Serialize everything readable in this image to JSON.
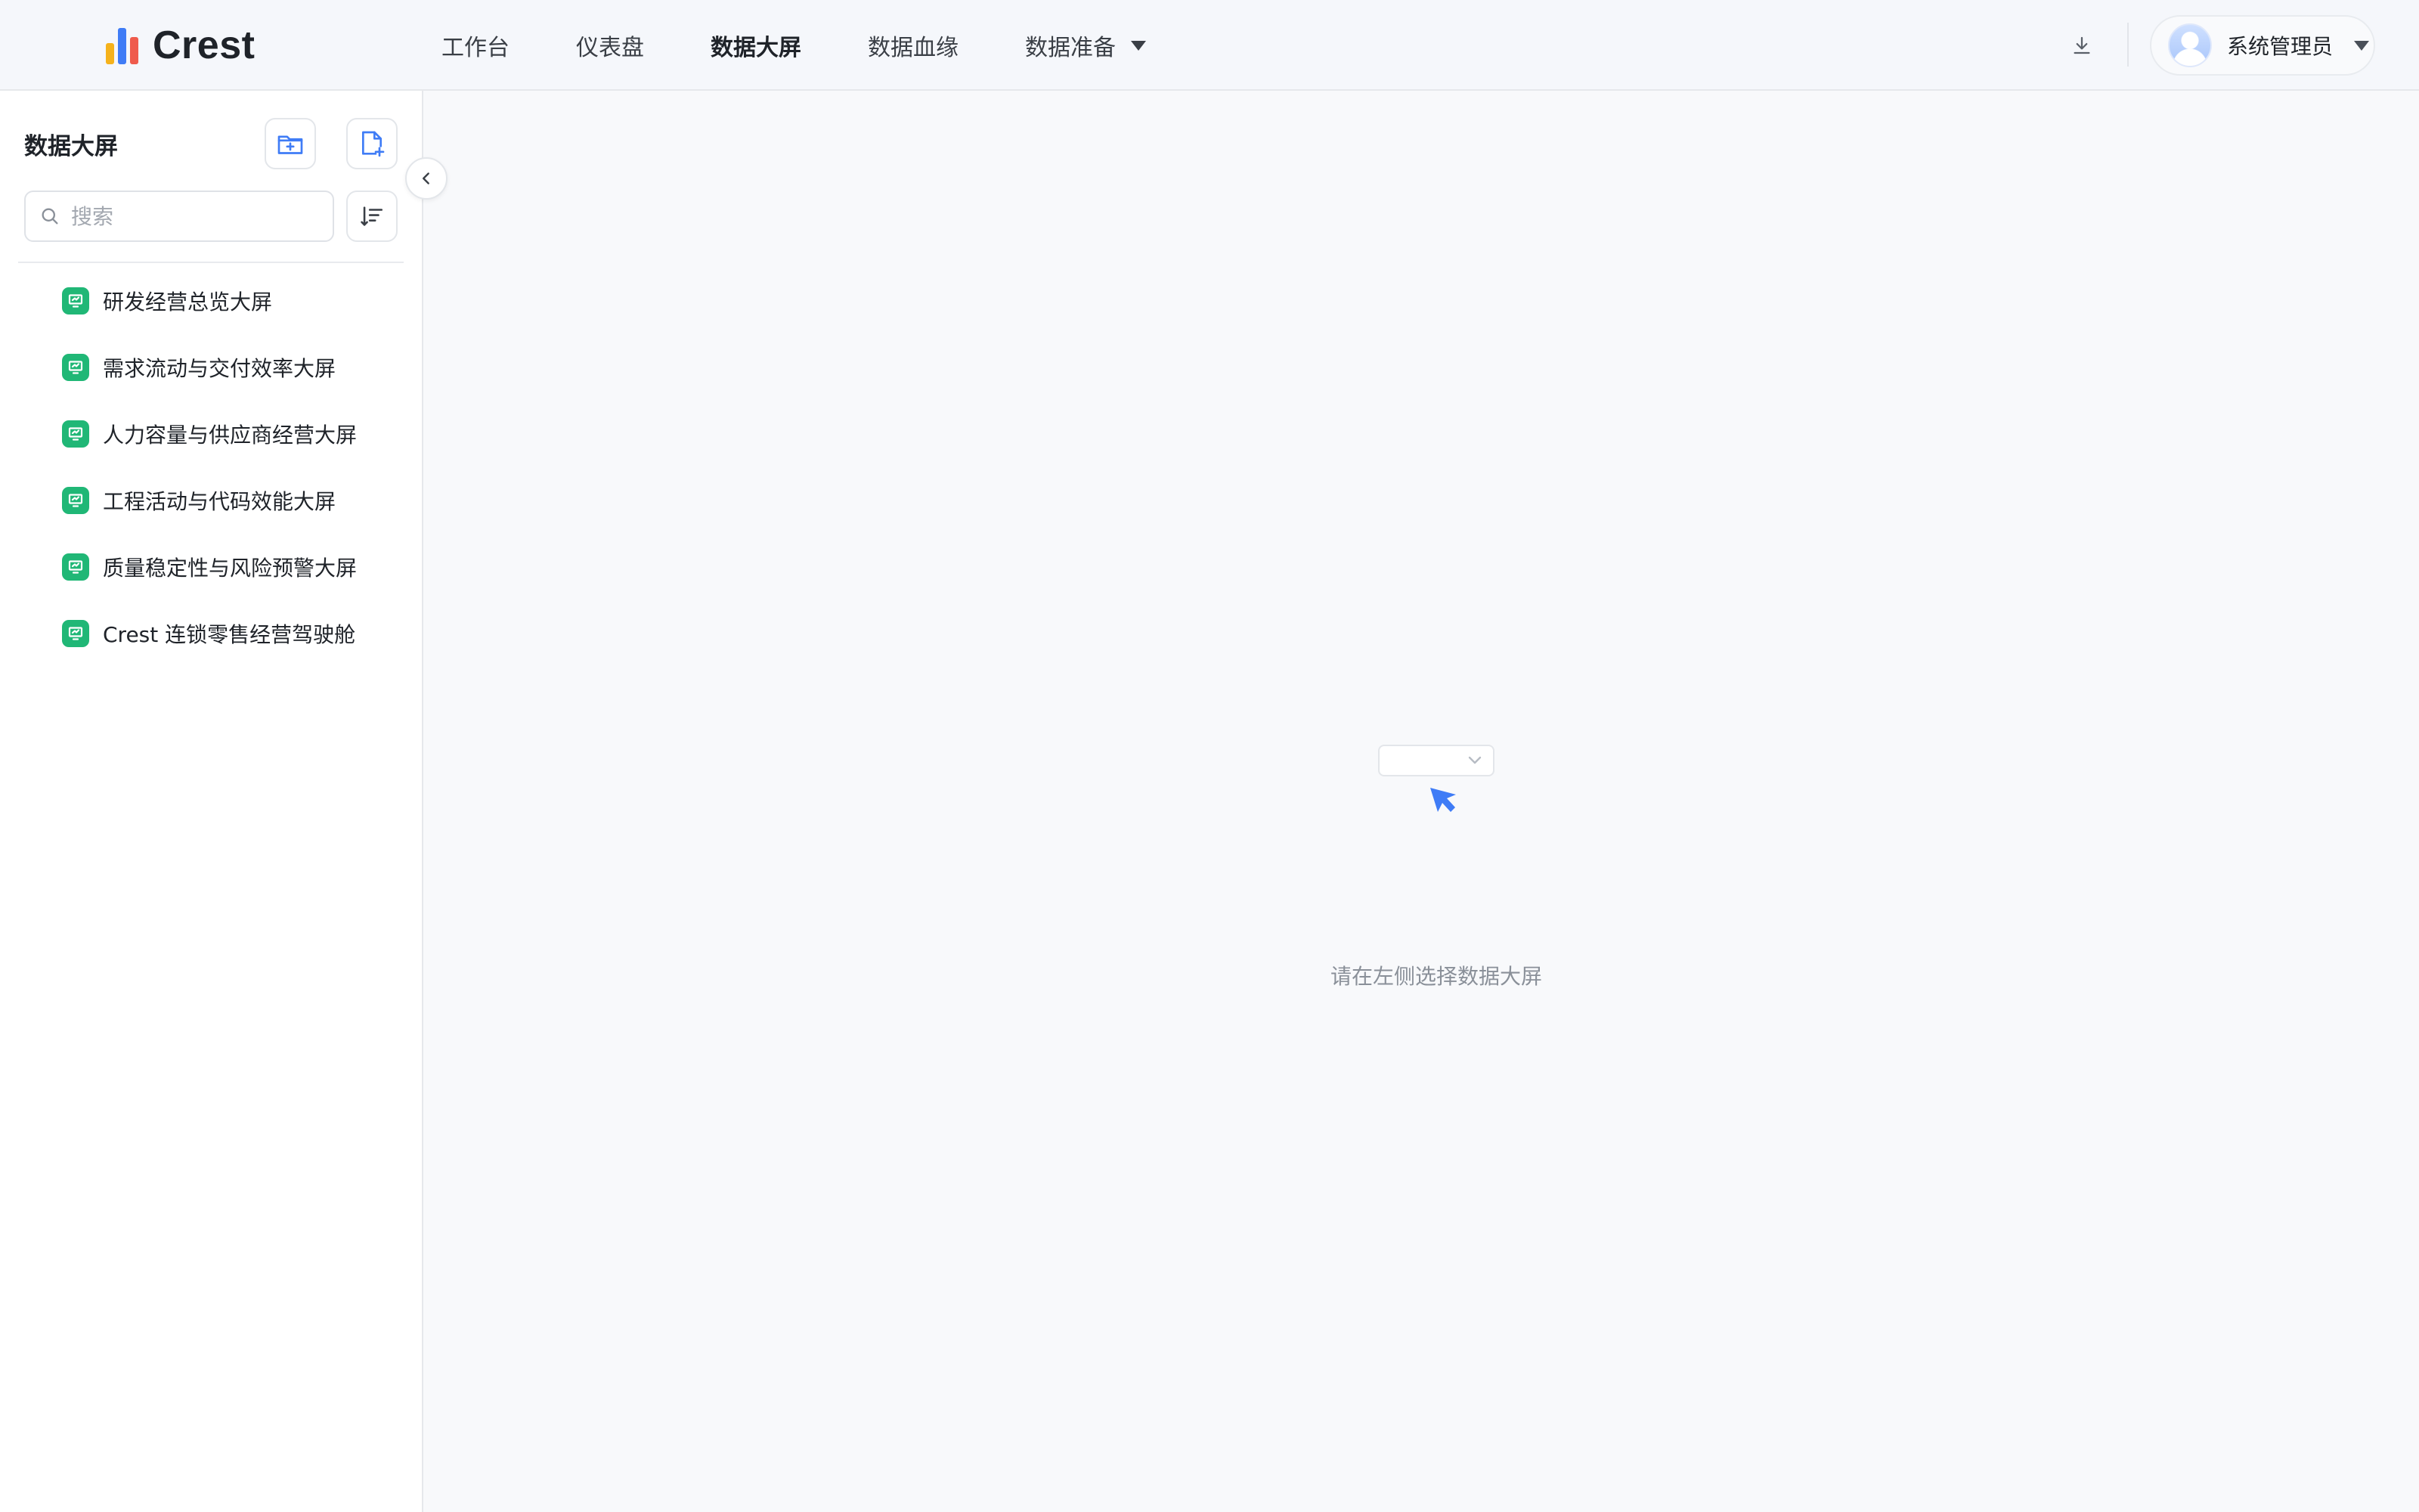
{
  "app": {
    "name": "Crest"
  },
  "nav": {
    "items": [
      {
        "label": "工作台"
      },
      {
        "label": "仪表盘"
      },
      {
        "label": "数据大屏",
        "active": true
      },
      {
        "label": "数据血缘"
      },
      {
        "label": "数据准备",
        "has_dropdown": true
      }
    ]
  },
  "user": {
    "name": "系统管理员"
  },
  "sidebar": {
    "title": "数据大屏",
    "search_placeholder": "搜索",
    "items": [
      {
        "label": "研发经营总览大屏"
      },
      {
        "label": "需求流动与交付效率大屏"
      },
      {
        "label": "人力容量与供应商经营大屏"
      },
      {
        "label": "工程活动与代码效能大屏"
      },
      {
        "label": "质量稳定性与风险预警大屏"
      },
      {
        "label": "Crest 连锁零售经营驾驶舱"
      }
    ]
  },
  "empty_state": {
    "message": "请在左侧选择数据大屏"
  },
  "colors": {
    "accent": "#3f7cf6",
    "item_icon": "#20b776",
    "header_bg": "#f5f7fb",
    "page_bg": "#f8f9fb"
  }
}
